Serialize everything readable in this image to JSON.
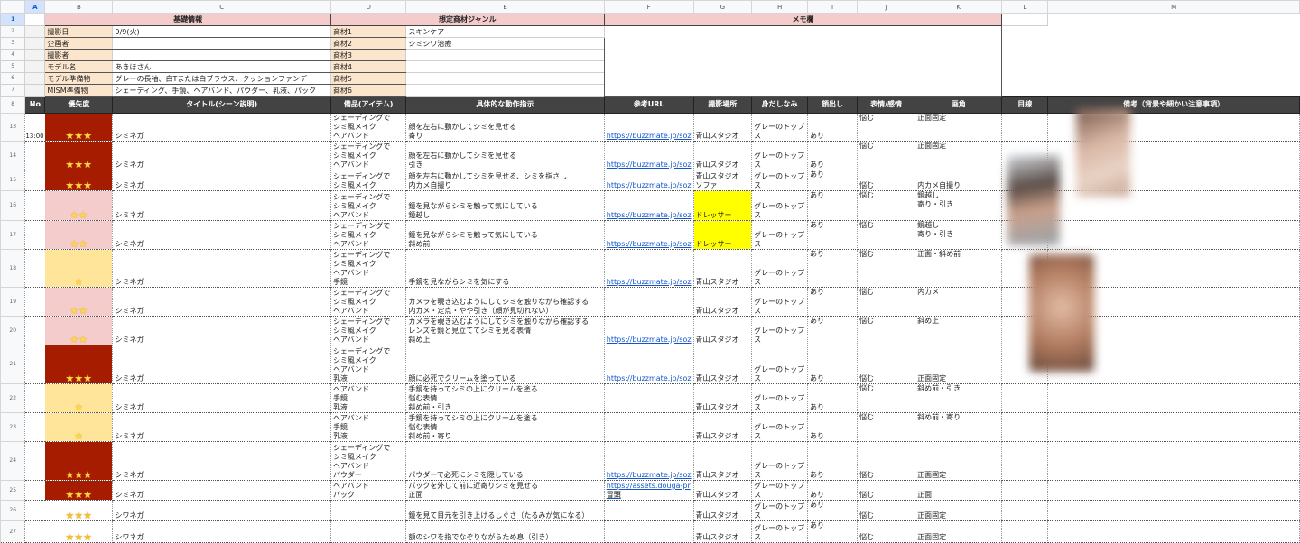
{
  "columns": [
    "A",
    "B",
    "C",
    "D",
    "E",
    "F",
    "G",
    "H",
    "I",
    "J",
    "K",
    "L",
    "M"
  ],
  "sections": {
    "basic": "基礎情報",
    "genre": "想定商材ジャンル",
    "memo": "メモ欄"
  },
  "basic_info": [
    {
      "label": "撮影日",
      "value": "9/9(火)"
    },
    {
      "label": "企画者",
      "value": ""
    },
    {
      "label": "撮影者",
      "value": ""
    },
    {
      "label": "モデル名",
      "value": "あきほさん"
    },
    {
      "label": "モデル準備物",
      "value": "グレーの長袖、白Tまたは白ブラウス、クッションファンデ"
    },
    {
      "label": "MISM準備物",
      "value": "シェーディング、手鏡、ヘアバンド、パウダー、乳液、パック"
    }
  ],
  "genres": [
    {
      "label": "商材1",
      "value": "スキンケア"
    },
    {
      "label": "商材2",
      "value": "シミシワ治療"
    },
    {
      "label": "商材3",
      "value": ""
    },
    {
      "label": "商材4",
      "value": ""
    },
    {
      "label": "商材5",
      "value": ""
    },
    {
      "label": "商材6",
      "value": ""
    }
  ],
  "headers": [
    "No",
    "優先度",
    "タイトル(シーン説明)",
    "備品(アイテム)",
    "具体的な動作指示",
    "参考URL",
    "撮影場所",
    "身だしなみ",
    "顔出し",
    "表情/感情",
    "画角",
    "目線",
    "備考（背景や細かい注意事項）"
  ],
  "colors": {
    "p3": "#a61c00",
    "p2": "#f4cccc",
    "p1": "#ffe599",
    "header": "#434343",
    "section": "#f4cccc",
    "label": "#fce5cd"
  },
  "rows": [
    {
      "n": "13",
      "no": "13:00",
      "stars": "★★★",
      "p": 3,
      "title": "シミネガ",
      "items": "シェーディングで\nシミ風メイク\nヘアバンド",
      "action": "顔を左右に動かしてシミを見せる\n寄り",
      "url": "https://buzzmate.jp/soz",
      "place": "青山スタジオ",
      "dress": "グレーのトップ\nス",
      "face": "あり",
      "emo": "悩む",
      "angle": "正面固定",
      "eye": "",
      "note": ""
    },
    {
      "n": "14",
      "no": "",
      "stars": "★★★",
      "p": 3,
      "title": "シミネガ",
      "items": "シェーディングで\nシミ風メイク\nヘアバンド",
      "action": "顔を左右に動かしてシミを見せる\n引き",
      "url": "https://buzzmate.jp/soz",
      "place": "青山スタジオ",
      "dress": "グレーのトップ\nス",
      "face": "あり",
      "emo": "悩む",
      "angle": "正面固定",
      "eye": "",
      "note": ""
    },
    {
      "n": "15",
      "no": "",
      "stars": "★★★",
      "p": 3,
      "title": "シミネガ",
      "items": "シェーディングで\nシミ風メイク",
      "action": "顔を左右に動かしてシミを見せる、シミを指さし\n内カメ自撮り",
      "url": "https://buzzmate.jp/soz",
      "place": "青山スタジオ\nソファ",
      "dress": "グレーのトップ\nス",
      "face": "あり",
      "emo": "悩む",
      "angle": "内カメ自撮り",
      "eye": "",
      "note": ""
    },
    {
      "n": "16",
      "no": "",
      "stars": "★★",
      "p": 2,
      "title": "シミネガ",
      "items": "シェーディングで\nシミ風メイク\nヘアバンド",
      "action": "鏡を見ながらシミを触って気にしている\n鏡越し",
      "url": "https://buzzmate.jp/soz",
      "place": "ドレッサー",
      "hl": true,
      "dress": "グレーのトップ\nス",
      "face": "あり",
      "emo": "悩む",
      "angle": "鏡越し\n寄り・引き",
      "eye": "",
      "note": ""
    },
    {
      "n": "17",
      "no": "",
      "stars": "★★",
      "p": 2,
      "title": "シミネガ",
      "items": "シェーディングで\nシミ風メイク\nヘアバンド",
      "action": "鏡を見ながらシミを触って気にしている\n斜め前",
      "url": "https://buzzmate.jp/soz",
      "place": "ドレッサー",
      "hl": true,
      "dress": "グレーのトップ\nス",
      "face": "あり",
      "emo": "悩む",
      "angle": "鏡越し\n寄り・引き",
      "eye": "",
      "note": ""
    },
    {
      "n": "18",
      "no": "",
      "stars": "★",
      "p": 1,
      "title": "シミネガ",
      "items": "シェーディングで\nシミ風メイク\nヘアバンド\n手鏡",
      "action": "手鏡を見ながらシミを気にする",
      "url": "https://buzzmate.jp/soz",
      "place": "青山スタジオ",
      "dress": "グレーのトップ\nス",
      "face": "あり",
      "emo": "悩む",
      "angle": "正面・斜め前",
      "eye": "",
      "note": ""
    },
    {
      "n": "19",
      "no": "",
      "stars": "★★",
      "p": 2,
      "title": "シミネガ",
      "items": "シェーディングで\nシミ風メイク\nヘアバンド",
      "action": "カメラを覗き込むようにしてシミを触りながら確認する\n内カメ・定点・やや引き（顔が見切れない）",
      "url": "",
      "place": "青山スタジオ",
      "dress": "グレーのトップ\nス",
      "face": "あり",
      "emo": "悩む",
      "angle": "内カメ",
      "eye": "",
      "note": ""
    },
    {
      "n": "20",
      "no": "",
      "stars": "★★",
      "p": 2,
      "title": "シミネガ",
      "items": "シェーディングで\nシミ風メイク\nヘアバンド",
      "action": "カメラを覗き込むようにしてシミを触りながら確認する\nレンズを鏡と見立ててシミを見る表情\n斜め上",
      "url": "https://buzzmate.jp/soz",
      "place": "青山スタジオ",
      "dress": "グレーのトップ\nス",
      "face": "あり",
      "emo": "悩む",
      "angle": "斜め上",
      "eye": "",
      "note": ""
    },
    {
      "n": "21",
      "no": "",
      "stars": "★★★",
      "p": 3,
      "title": "シミネガ",
      "items": "シェーディングで\nシミ風メイク\nヘアバンド\n乳液",
      "action": "顔に必死でクリームを塗っている",
      "url": "https://buzzmate.jp/soz",
      "place": "青山スタジオ",
      "dress": "グレーのトップ\nス",
      "face": "あり",
      "emo": "悩む",
      "angle": "正面固定",
      "eye": "",
      "note": ""
    },
    {
      "n": "22",
      "no": "",
      "stars": "★",
      "p": 1,
      "title": "シミネガ",
      "items": "ヘアバンド\n手鏡\n乳液",
      "action": "手鏡を持ってシミの上にクリームを塗る\n悩む表情\n斜め前・引き",
      "url": "",
      "place": "青山スタジオ",
      "dress": "グレーのトップ\nス",
      "face": "あり",
      "emo": "悩む",
      "angle": "斜め前・引き",
      "eye": "",
      "note": ""
    },
    {
      "n": "23",
      "no": "",
      "stars": "★",
      "p": 1,
      "title": "シミネガ",
      "items": "ヘアバンド\n手鏡\n乳液",
      "action": "手鏡を持ってシミの上にクリームを塗る\n悩む表情\n斜め前・寄り",
      "url": "",
      "place": "青山スタジオ",
      "dress": "グレーのトップ\nス",
      "face": "あり",
      "emo": "悩む",
      "angle": "斜め前・寄り",
      "eye": "",
      "note": ""
    },
    {
      "n": "24",
      "no": "",
      "stars": "★★★",
      "p": 3,
      "title": "シミネガ",
      "items": "シェーディングで\nシミ風メイク\nヘアバンド\nパウダー",
      "action": "パウダーで必死にシミを隠している",
      "url": "https://buzzmate.jp/soz",
      "place": "青山スタジオ",
      "dress": "グレーのトップ\nス",
      "face": "あり",
      "emo": "悩む",
      "angle": "正面固定",
      "eye": "",
      "note": ""
    },
    {
      "n": "25",
      "no": "",
      "stars": "★★★",
      "p": 3,
      "title": "シミネガ",
      "items": "ヘアバンド\nパック",
      "action": "パックを外して前に近寄りシミを見せる\n正面",
      "url": "https://assets.douga-pr",
      "url2": "冒頭",
      "place": "青山スタジオ",
      "dress": "グレーのトップ\nス",
      "face": "あり",
      "emo": "悩む",
      "angle": "正面",
      "eye": "",
      "note": ""
    },
    {
      "n": "26",
      "no": "",
      "stars": "★★★",
      "p": 0,
      "title": "シワネガ",
      "items": "",
      "action": "鏡を見て目元を引き上げるしぐさ（たるみが気になる）",
      "url": "",
      "place": "青山スタジオ",
      "dress": "グレーのトップ\nス",
      "face": "あり",
      "emo": "悩む",
      "angle": "正面固定",
      "eye": "",
      "note": ""
    },
    {
      "n": "27",
      "no": "",
      "stars": "★★★",
      "p": 0,
      "title": "シワネガ",
      "items": "",
      "action": "額のシワを指でなぞりながらため息（引き）",
      "url": "",
      "place": "青山スタジオ",
      "dress": "グレーのトップ\nス",
      "face": "あり",
      "emo": "悩む",
      "angle": "正面固定",
      "eye": "",
      "note": ""
    }
  ]
}
